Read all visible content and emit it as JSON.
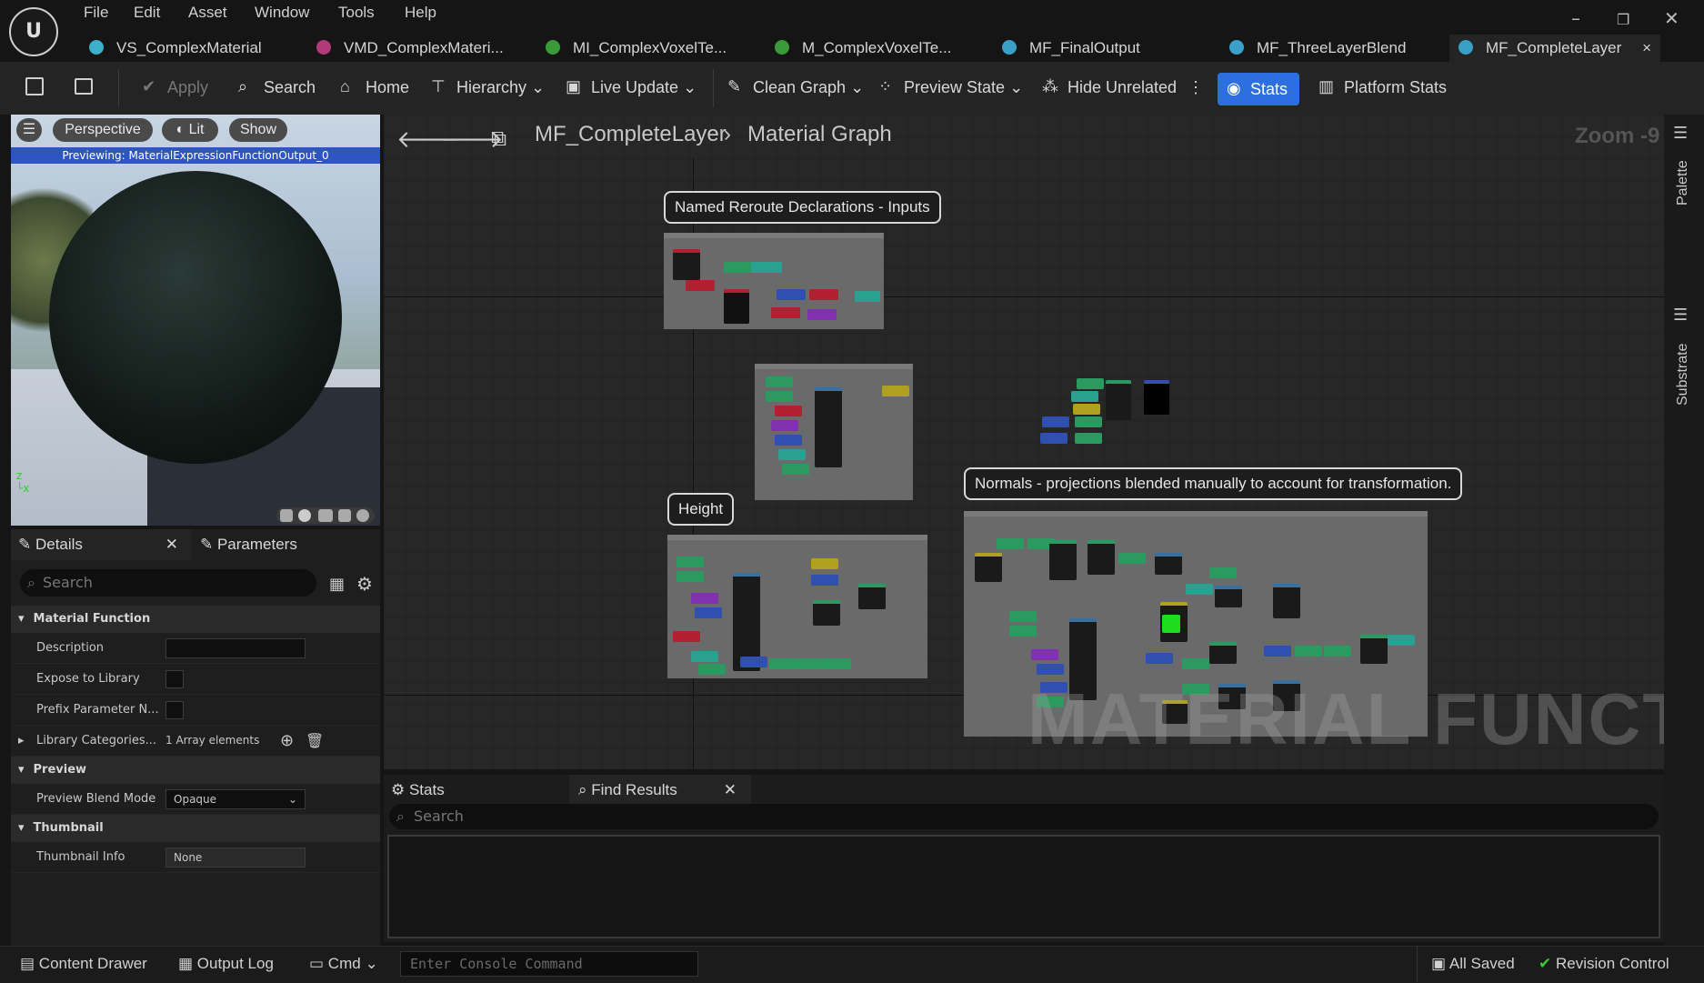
{
  "menu": [
    "File",
    "Edit",
    "Asset",
    "Window",
    "Tools",
    "Help"
  ],
  "tabs": [
    {
      "label": "VS_ComplexMaterial",
      "color": "#3bb0c8"
    },
    {
      "label": "VMD_ComplexMateri...",
      "color": "#b03a7a"
    },
    {
      "label": "MI_ComplexVoxelTe...",
      "color": "#3a9a3a"
    },
    {
      "label": "M_ComplexVoxelTe...",
      "color": "#3a9a3a"
    },
    {
      "label": "MF_FinalOutput",
      "color": "#3ba0c8"
    },
    {
      "label": "MF_ThreeLayerBlend",
      "color": "#3ba0c8"
    },
    {
      "label": "MF_CompleteLayer",
      "color": "#3ba0c8"
    }
  ],
  "tab_close": "×",
  "toolbar": {
    "apply": "Apply",
    "search": "Search",
    "home": "Home",
    "hierarchy": "Hierarchy",
    "live_update": "Live Update",
    "clean_graph": "Clean Graph",
    "preview_state": "Preview State",
    "hide_unrelated": "Hide Unrelated",
    "stats": "Stats",
    "platform_stats": "Platform Stats"
  },
  "viewport": {
    "perspective": "Perspective",
    "lit": "Lit",
    "show": "Show",
    "previewing": "Previewing: MaterialExpressionFunctionOutput_0"
  },
  "details": {
    "tab_details": "Details",
    "tab_parameters": "Parameters",
    "search_placeholder": "Search",
    "sections": {
      "material_function": "Material Function",
      "preview": "Preview",
      "thumbnail": "Thumbnail"
    },
    "rows": {
      "description": "Description",
      "expose": "Expose to Library",
      "prefix": "Prefix Parameter N...",
      "library_categories": "Library Categories...",
      "array_elements": "1 Array elements",
      "preview_blend_mode": "Preview Blend Mode",
      "blend_value": "Opaque",
      "thumbnail_info": "Thumbnail Info",
      "thumbnail_value": "None"
    }
  },
  "graph": {
    "asset": "MF_CompleteLayer",
    "section": "Material Graph",
    "zoom": "Zoom -9",
    "comments": {
      "reroute": "Named Reroute Declarations - Inputs",
      "height": "Height",
      "normals": "Normals - projections blended manually to account for transformation."
    },
    "watermark": "MATERIAL FUNCTION"
  },
  "side": {
    "palette": "Palette",
    "substrate": "Substrate"
  },
  "stats_panel": {
    "stats": "Stats",
    "find_results": "Find Results",
    "search_placeholder": "Search"
  },
  "bottom": {
    "content_drawer": "Content Drawer",
    "output_log": "Output Log",
    "cmd": "Cmd",
    "console_placeholder": "Enter Console Command",
    "all_saved": "All Saved",
    "revision_control": "Revision Control"
  }
}
